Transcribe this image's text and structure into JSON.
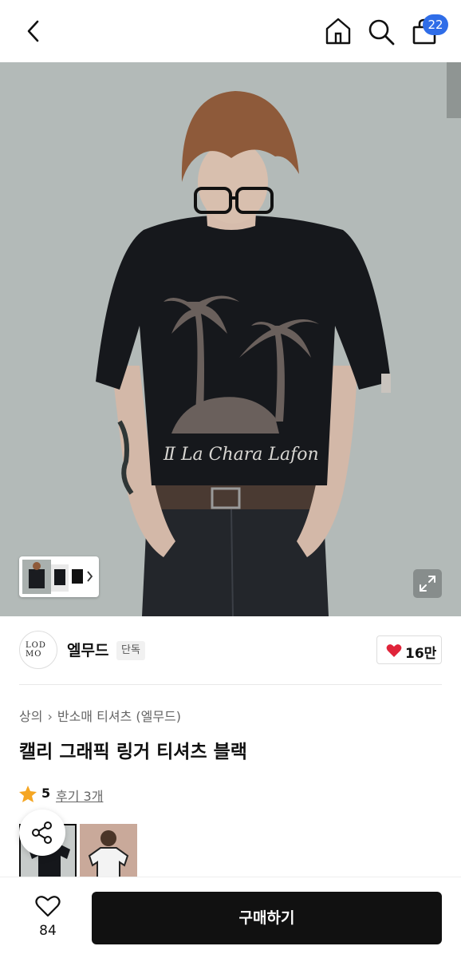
{
  "header": {
    "cart_count": "22",
    "icons": [
      "back-icon",
      "home-icon",
      "search-icon",
      "cart-icon"
    ]
  },
  "brand": {
    "logo_text": "LOD MO",
    "name": "엘무드",
    "exclusive_badge": "단독",
    "likes": "16만",
    "like_color": "#e0243a"
  },
  "product": {
    "breadcrumb": [
      "상의",
      "반소매 티셔츠 (엘무드)"
    ],
    "title": "캘리 그래픽 링거 티셔츠 블랙",
    "rating": "5",
    "reviews": "후기 3개",
    "star_color": "#f5a623",
    "shirt_print": "Ⅱ La Chara Lafon"
  },
  "bottom": {
    "wish_count": "84",
    "buy_label": "구매하기"
  },
  "colors": {
    "accent": "#2f6de8",
    "buy_button": "#111111"
  }
}
